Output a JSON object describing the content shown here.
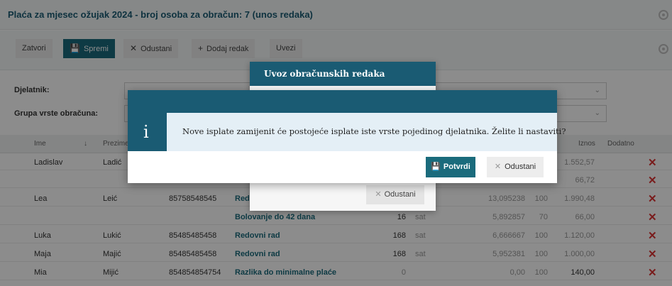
{
  "window": {
    "title": "Plaća za mjesec ožujak 2024 - broj osoba za obračun: 7 (unos redaka)"
  },
  "toolbar": {
    "close_label": "Zatvori",
    "save_label": "Spremi",
    "cancel_label": "Odustani",
    "add_row_label": "Dodaj redak",
    "import_label": "Uvezi"
  },
  "filters": {
    "employee_label": "Djelatnik:",
    "group_label": "Grupa vrste obračuna:"
  },
  "table": {
    "headers": {
      "ime": "Ime",
      "sort_arrow": "↓",
      "prezime": "Prezime",
      "iznos": "Iznos",
      "dodatno": "Dodatno"
    },
    "rows": [
      {
        "ime": "Ladislav",
        "prezime": "Ladić",
        "oib": "",
        "vrsta": "",
        "sati": "",
        "jed": "",
        "koef": "",
        "posto": "",
        "iznos": "1.552,57"
      },
      {
        "ime": "",
        "prezime": "",
        "oib": "",
        "vrsta": "",
        "sati": "",
        "jed": "",
        "koef": "",
        "posto": "",
        "iznos": "66,72"
      },
      {
        "ime": "Lea",
        "prezime": "Leić",
        "oib": "85758548545",
        "vrsta": "Redo",
        "sati": "",
        "jed": "",
        "koef": "13,095238",
        "posto": "100",
        "iznos": "1.990,48"
      },
      {
        "ime": "",
        "prezime": "",
        "oib": "",
        "vrsta": "Bolovanje do 42 dana",
        "sati": "16",
        "jed": "sat",
        "koef": "5,892857",
        "posto": "70",
        "iznos": "66,00"
      },
      {
        "ime": "Luka",
        "prezime": "Lukić",
        "oib": "85485485458",
        "vrsta": "Redovni rad",
        "sati": "168",
        "jed": "sat",
        "koef": "6,666667",
        "posto": "100",
        "iznos": "1.120,00"
      },
      {
        "ime": "Maja",
        "prezime": "Majić",
        "oib": "85485485458",
        "vrsta": "Redovni rad",
        "sati": "168",
        "jed": "sat",
        "koef": "5,952381",
        "posto": "100",
        "iznos": "1.000,00"
      },
      {
        "ime": "Mia",
        "prezime": "Mijić",
        "oib": "854854854754",
        "vrsta": "Razlika do minimalne plaće",
        "sati": "0",
        "jed": "",
        "koef": "0,00",
        "posto": "100",
        "iznos": "140,00"
      }
    ]
  },
  "import_dialog": {
    "title": "Uvoz obračunskih redaka",
    "cancel_label": "Odustani"
  },
  "confirm_dialog": {
    "icon_glyph": "i",
    "message": "Nove isplate zamijenit će postojeće isplate iste vrste pojedinog djelatnika. Želite li nastaviti?",
    "confirm_label": "Potvrdi",
    "cancel_label": "Odustani"
  },
  "colors": {
    "brand": "#1a5b73",
    "button_primary": "#1a6b7c",
    "message_bg": "#e4eff6",
    "delete": "#dd3333"
  }
}
